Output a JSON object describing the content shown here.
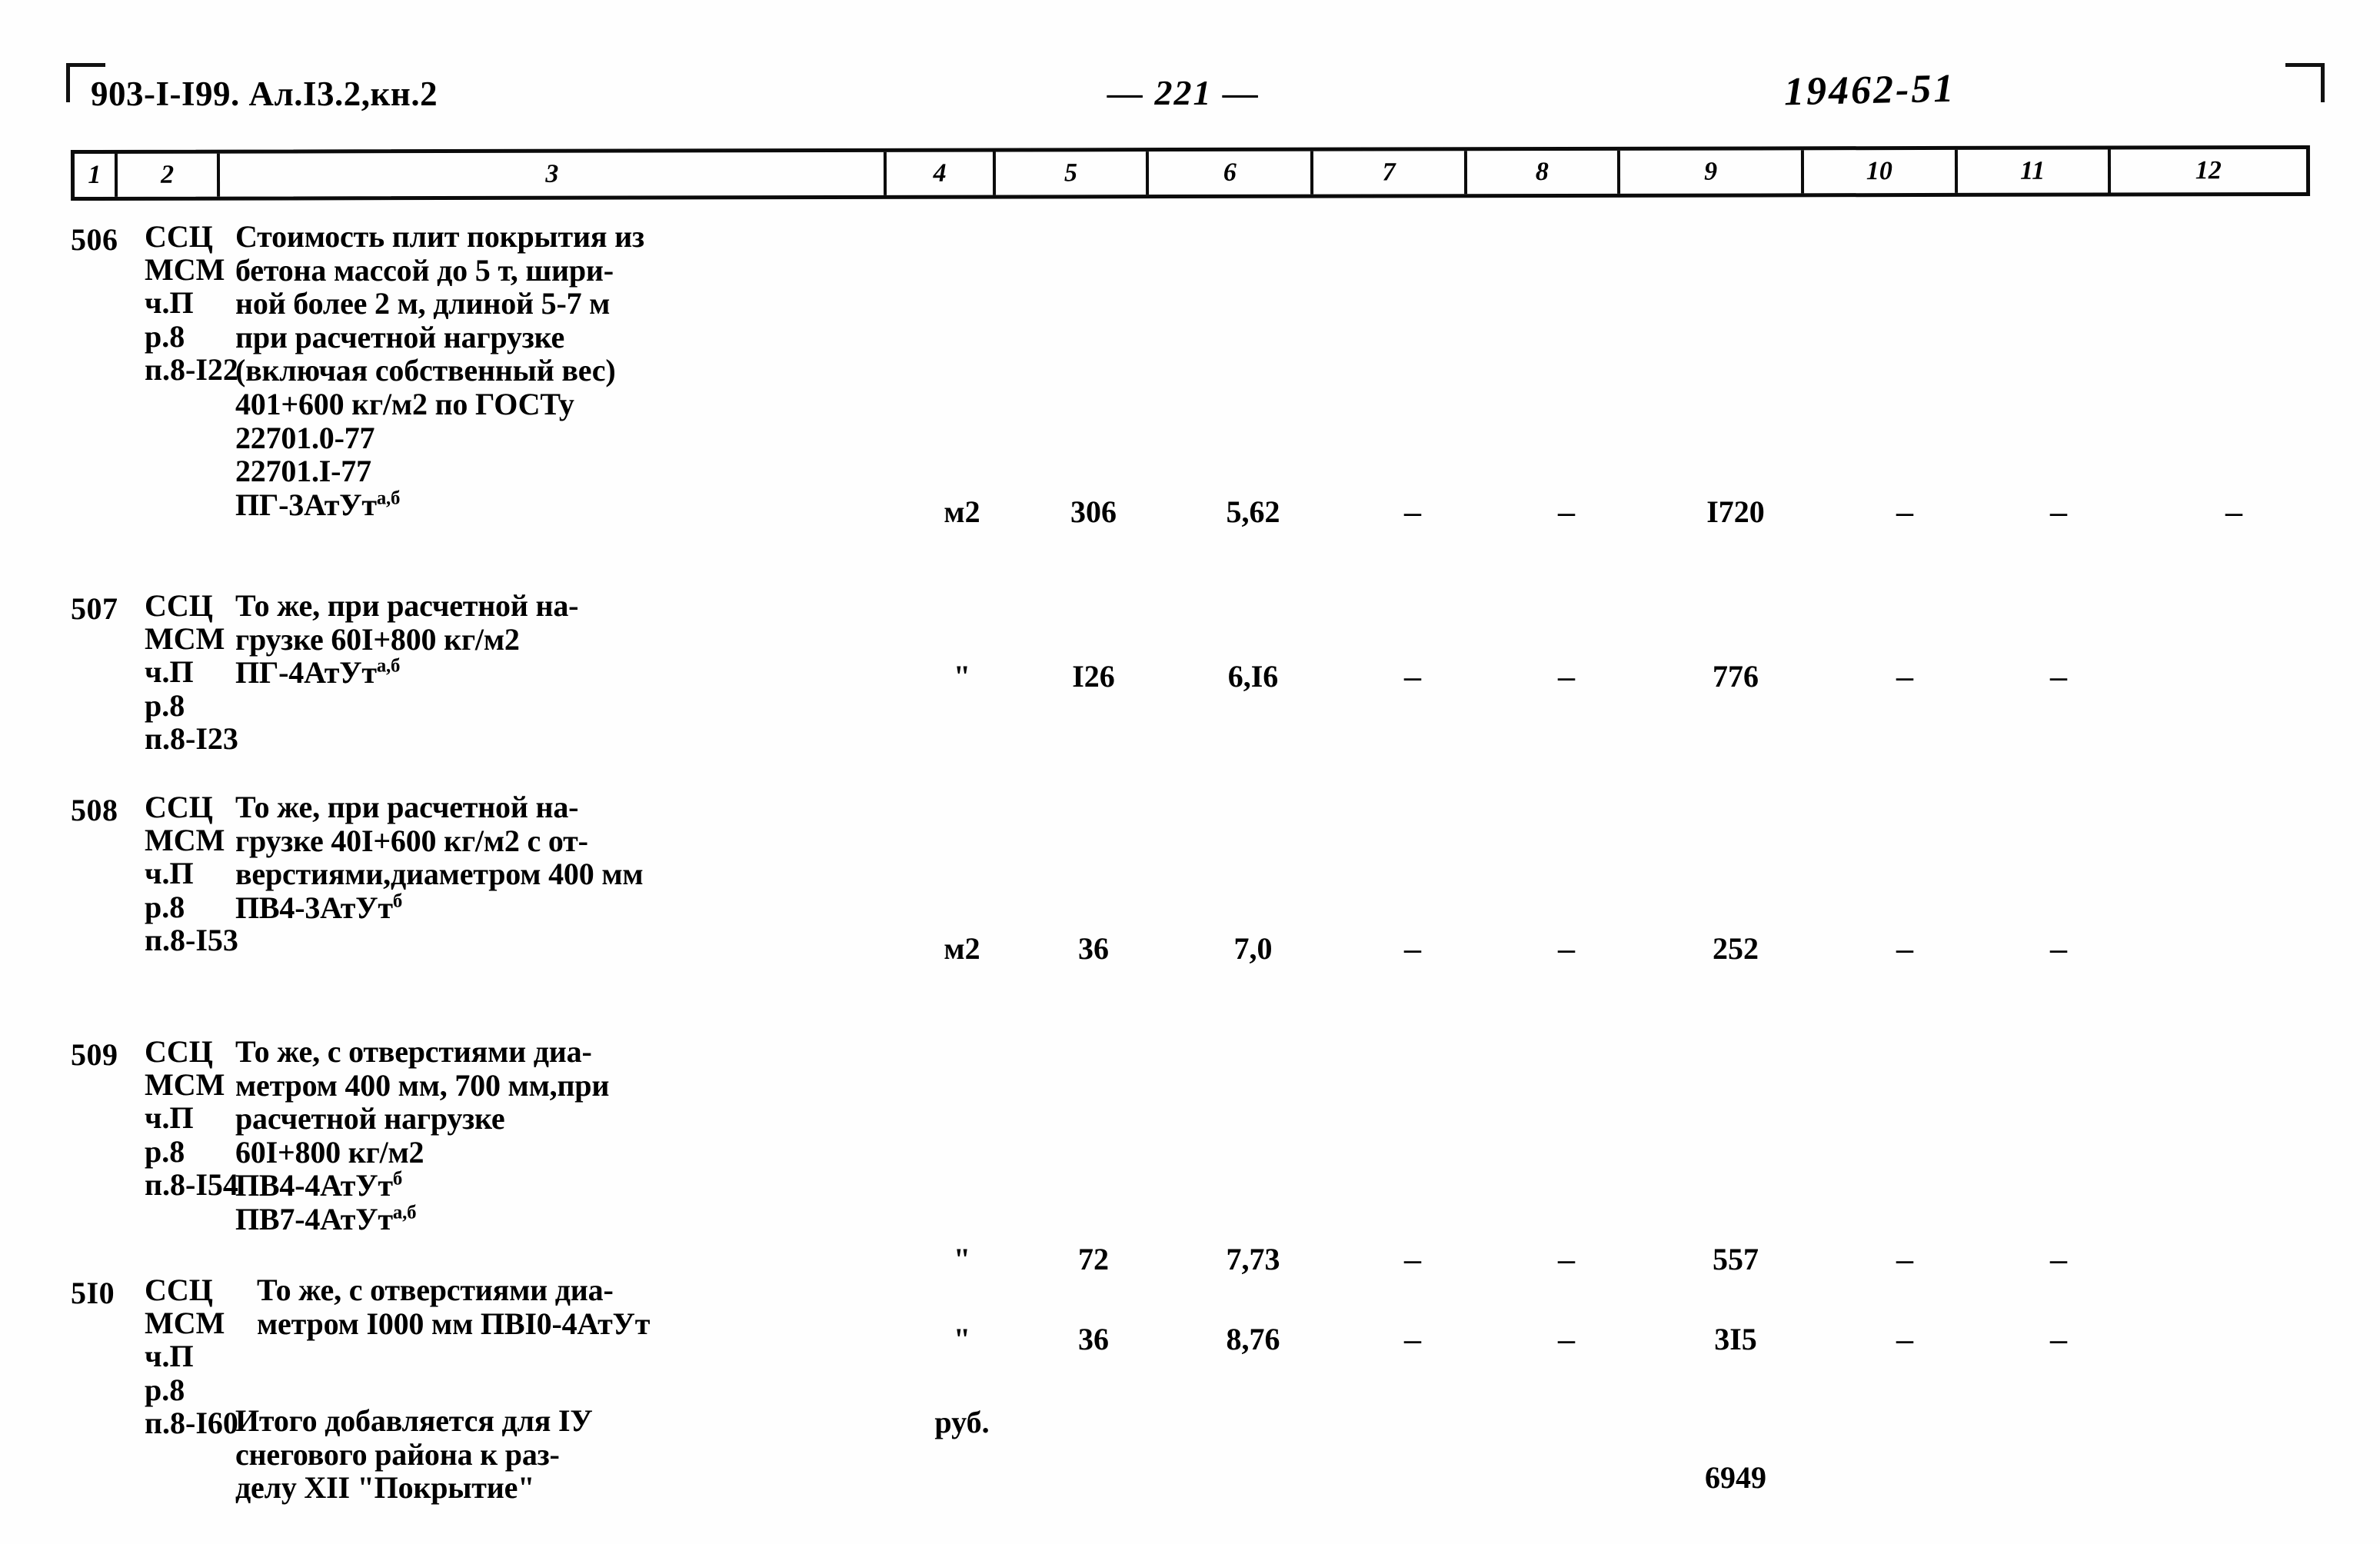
{
  "header": {
    "doc_code": "903-I-I99. Ал.I3.2,кн.2",
    "page_number": "— 221 —",
    "archive_number": "19462-51"
  },
  "table": {
    "column_numbers": [
      "1",
      "2",
      "3",
      "4",
      "5",
      "6",
      "7",
      "8",
      "9",
      "10",
      "11",
      "12"
    ],
    "rows": [
      {
        "num": "506",
        "code": "ССЦ\nМСМ\nч.П\nр.8\nп.8-I22",
        "desc_lines": [
          "Стоимость плит покрытия из",
          "бетона массой до 5 т, шири-",
          "ной более 2 м, длиной 5-7 м",
          "при расчетной нагрузке",
          "(включая собственный вес)",
          "401+600 кг/м2 по ГОСТу",
          "22701.0-77",
          "22701.I-77"
        ],
        "desc_last": "ПГ-3АтУт",
        "desc_sup": "а,б",
        "unit": "м2",
        "qty": "306",
        "price": "5,62",
        "c7": "–",
        "c8": "–",
        "total": "I720",
        "c10": "–",
        "c11": "–",
        "c12": "–"
      },
      {
        "num": "507",
        "code": "ССЦ\nМСМ\nч.П\nр.8\nп.8-I23",
        "desc_lines": [
          "То же, при расчетной на-",
          "грузке 60I+800 кг/м2"
        ],
        "desc_last": "ПГ-4АтУт",
        "desc_sup": "а,б",
        "unit": "\"",
        "qty": "I26",
        "price": "6,I6",
        "c7": "–",
        "c8": "–",
        "total": "776",
        "c10": "–",
        "c11": "–",
        "c12": ""
      },
      {
        "num": "508",
        "code": "ССЦ\nМСМ\nч.П\nр.8\nп.8-I53",
        "desc_lines": [
          "То же, при расчетной на-",
          "грузке 40I+600 кг/м2 с от-",
          "верстиями,диаметром 400 мм"
        ],
        "desc_last": "ПВ4-3АтУт",
        "desc_sup": "б",
        "unit": "м2",
        "qty": "36",
        "price": "7,0",
        "c7": "–",
        "c8": "–",
        "total": "252",
        "c10": "–",
        "c11": "–",
        "c12": ""
      },
      {
        "num": "509",
        "code": "ССЦ\nМСМ\nч.П\nр.8\nп.8-I54",
        "desc_lines": [
          "То же, с отверстиями диа-",
          "метром 400 мм, 700 мм,при",
          "расчетной нагрузке",
          "60I+800 кг/м2"
        ],
        "desc_mid": "ПВ4-4АтУт",
        "desc_mid_sup": "б",
        "desc_last": "ПВ7-4АтУт",
        "desc_sup": "а,б",
        "unit": "\"",
        "qty": "72",
        "price": "7,73",
        "c7": "–",
        "c8": "–",
        "total": "557",
        "c10": "–",
        "c11": "–",
        "c12": ""
      },
      {
        "num": "5I0",
        "code": "ССЦ\nМСМ\nч.П\nр.8\nп.8-I60",
        "desc_lines": [
          "То же, с отверстиями диа-",
          "метром I000 мм ПВI0-4АтУт"
        ],
        "desc_last": "",
        "desc_sup": "",
        "unit": "\"",
        "qty": "36",
        "price": "8,76",
        "c7": "–",
        "c8": "–",
        "total": "3I5",
        "c10": "–",
        "c11": "–",
        "c12": ""
      }
    ],
    "summary": {
      "desc_lines": [
        "Итого добавляется для IУ",
        "снегового района к раз-",
        "делу ХII \"Покрытие\""
      ],
      "unit": "руб.",
      "total": "6949"
    }
  }
}
